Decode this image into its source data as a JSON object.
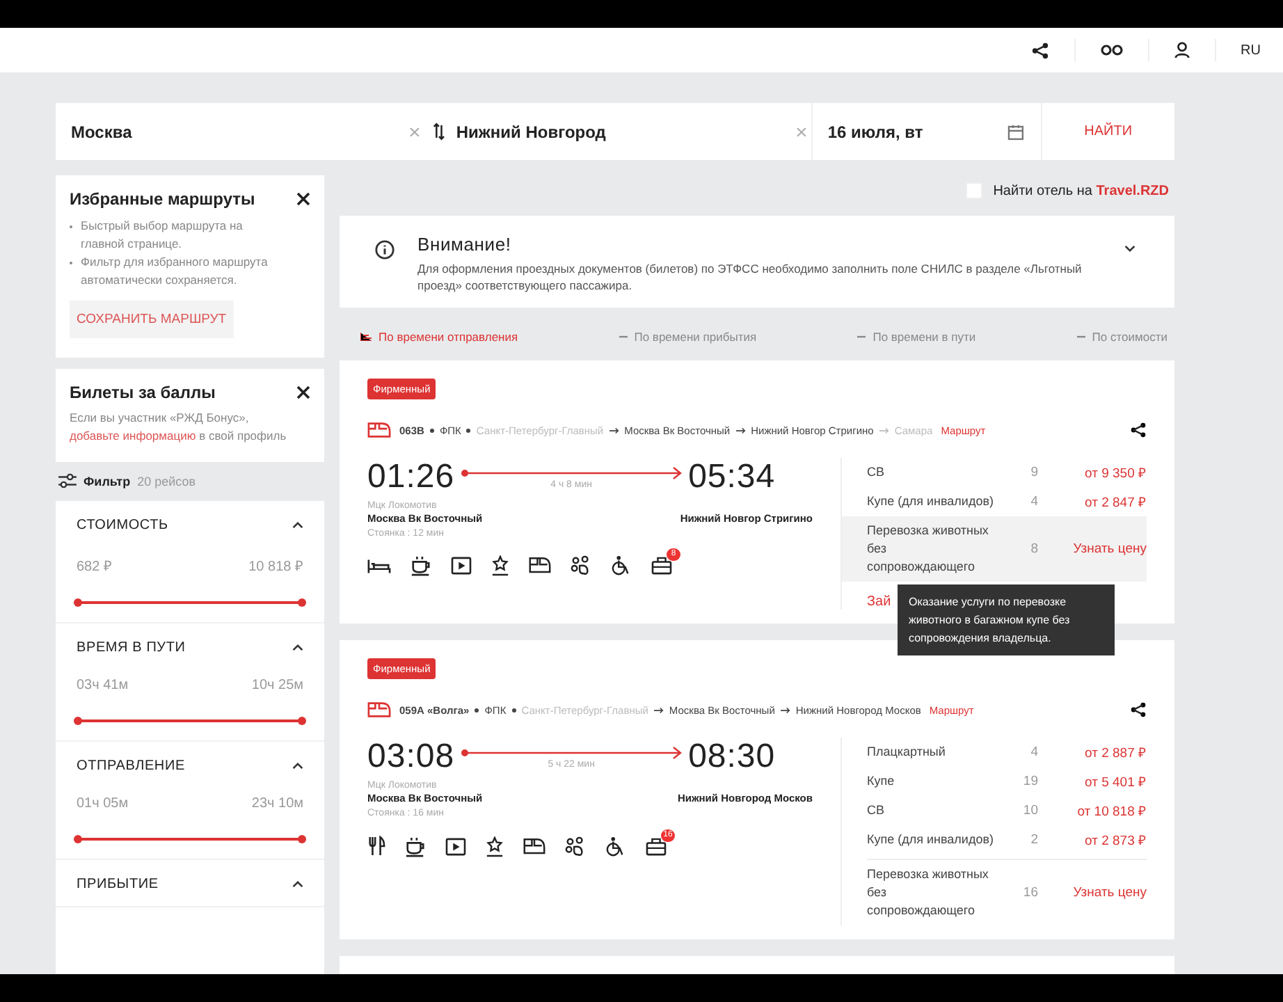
{
  "header": {
    "language": "RU"
  },
  "search": {
    "from": "Москва",
    "to": "Нижний Новгород",
    "date": "16 июля, вт",
    "button": "НАЙТИ"
  },
  "favorites": {
    "title": "Избранные маршруты",
    "bullets": [
      "Быстрый выбор маршрута на главной странице.",
      "Фильтр для избранного маршрута автоматически сохраняется."
    ],
    "button": "СОХРАНИТЬ МАРШРУТ"
  },
  "bonus": {
    "title": "Билеты за баллы",
    "text_before": "Если вы участник «РЖД Бонус»,",
    "link": "добавьте информацию",
    "text_after": "в свой профиль"
  },
  "filter": {
    "label": "Фильтр",
    "count": "20 рейсов"
  },
  "filter_sections": [
    {
      "title": "СТОИМОСТЬ",
      "expanded": true,
      "min": "682 ₽",
      "max": "10 818 ₽",
      "level": 1
    },
    {
      "title": "ВРЕМЯ В ПУТИ",
      "expanded": true,
      "min": "03ч 41м",
      "max": "10ч 25м",
      "level": 1
    },
    {
      "title": "ОТПРАВЛЕНИЕ",
      "expanded": true,
      "min": "01ч 05м",
      "max": "23ч 10м",
      "level": 1
    },
    {
      "title": "ПРИБЫТИЕ",
      "expanded": true
    }
  ],
  "hotel": {
    "checked": false,
    "label": "Найти отель на",
    "link": "Travel.RZD"
  },
  "notice": {
    "title": "Внимание!",
    "text": "Для оформления проездных документов (билетов) по ЭТФСС необходимо заполнить поле СНИЛС в разделе «Льготный проезд» соответствующего пассажира."
  },
  "sort": [
    {
      "label": "По времени отправления",
      "selected": true
    },
    {
      "label": "По времени прибытия",
      "selected": false
    },
    {
      "label": "По времени в пути",
      "selected": false
    },
    {
      "label": "По стоимости",
      "selected": false
    }
  ],
  "trains": [
    {
      "badge": "Фирменный",
      "number": "063В",
      "carrier": "ФПК",
      "stops": [
        {
          "name": "Санкт-Петербург-Главный",
          "faded": true
        },
        {
          "name": "Москва Вк Восточный",
          "faded": false
        },
        {
          "name": "Нижний Новгор Стригино",
          "faded": false
        },
        {
          "name": "Самара",
          "faded": true
        }
      ],
      "route_link": "Маршрут",
      "departure": "01:26",
      "arrival": "05:34",
      "duration": "4 ч 8 мин",
      "note": "Мцк Локомотив",
      "from_station": "Москва Вк Восточный",
      "to_station": "Нижний Новгор Стригино",
      "stop": "Стоянка : 12 мин",
      "amenities": [
        {
          "kind": "bed"
        },
        {
          "kind": "coffee"
        },
        {
          "kind": "video"
        },
        {
          "kind": "award"
        },
        {
          "kind": "train"
        },
        {
          "kind": "pet"
        },
        {
          "kind": "wheelchair"
        },
        {
          "kind": "luggage",
          "count": "8"
        }
      ],
      "classes": [
        {
          "name": "СВ",
          "seats": "9",
          "price": "от 9 350 ₽",
          "kind": "price",
          "highlighted": false
        },
        {
          "name": "Купе (для инвалидов)",
          "seats": "4",
          "price": "от 2 847 ₽",
          "kind": "price",
          "highlighted": false
        },
        {
          "name": "Перевозка животных без сопровождающего",
          "seats": "8",
          "price": "Узнать цену",
          "kind": "ask",
          "highlighted": true
        }
      ],
      "more": "Зай",
      "tooltip": "Оказание услуги по перевозке животного в багажном купе без сопровождения владельца."
    },
    {
      "badge": "Фирменный",
      "number": "059А «Волга»",
      "carrier": "ФПК",
      "stops": [
        {
          "name": "Санкт-Петербург-Главный",
          "faded": true
        },
        {
          "name": "Москва Вк Восточный",
          "faded": false
        },
        {
          "name": "Нижний Новгород Москов",
          "faded": false
        }
      ],
      "route_link": "Маршрут",
      "departure": "03:08",
      "arrival": "08:30",
      "duration": "5 ч 22 мин",
      "note": "Мцк Локомотив",
      "from_station": "Москва Вк Восточный",
      "to_station": "Нижний Новгород Москов",
      "stop": "Стоянка : 16 мин",
      "amenities": [
        {
          "kind": "food"
        },
        {
          "kind": "coffee"
        },
        {
          "kind": "video"
        },
        {
          "kind": "award"
        },
        {
          "kind": "train"
        },
        {
          "kind": "pet"
        },
        {
          "kind": "wheelchair"
        },
        {
          "kind": "luggage",
          "count": "16"
        }
      ],
      "classes": [
        {
          "name": "Плацкартный",
          "seats": "4",
          "price": "от 2 887 ₽",
          "kind": "price",
          "highlighted": false
        },
        {
          "name": "Купе",
          "seats": "19",
          "price": "от 5 401 ₽",
          "kind": "price",
          "highlighted": false
        },
        {
          "name": "СВ",
          "seats": "10",
          "price": "от 10 818 ₽",
          "kind": "price",
          "highlighted": false
        },
        {
          "name": "Купе (для инвалидов)",
          "seats": "2",
          "price": "от 2 873 ₽",
          "kind": "price",
          "highlighted": false
        },
        {
          "name": "Перевозка животных без сопровождающего",
          "seats": "16",
          "price": "Узнать цену",
          "kind": "ask",
          "highlighted": false
        }
      ]
    }
  ]
}
